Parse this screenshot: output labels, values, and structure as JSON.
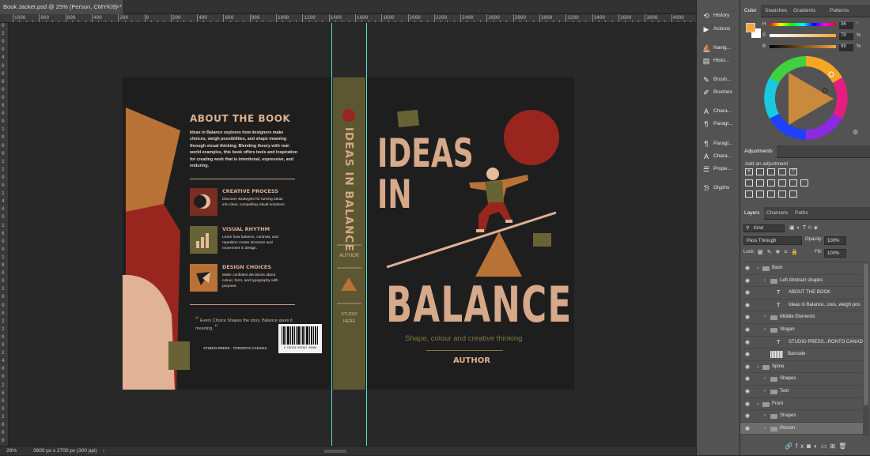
{
  "document": {
    "tab_title": "Book Jacket.psd @ 25% (Person, CMYK/8) *",
    "close": "×"
  },
  "rulers": {
    "h": [
      "1000",
      "800",
      "600",
      "400",
      "200",
      "0",
      "200",
      "400",
      "600",
      "800",
      "1000",
      "1200",
      "1400",
      "1600",
      "1800",
      "2000",
      "2200",
      "2400",
      "2600",
      "2800",
      "3000",
      "3200",
      "3400",
      "3600",
      "3800",
      "4000",
      "4200"
    ],
    "v": [
      "0",
      "2",
      "0",
      "0",
      "4",
      "0",
      "0",
      "6",
      "0",
      "0",
      "8",
      "0",
      "0",
      "1",
      "0",
      "0",
      "0",
      "1",
      "2",
      "0",
      "0",
      "1",
      "4",
      "0",
      "0",
      "1",
      "6",
      "0",
      "0",
      "1",
      "8",
      "0",
      "0",
      "2",
      "0",
      "0",
      "0",
      "2",
      "2",
      "0",
      "0",
      "2",
      "4",
      "0",
      "0",
      "2",
      "6",
      "0",
      "0",
      "2",
      "8",
      "0",
      "0"
    ]
  },
  "status": {
    "zoom": "29%",
    "doc_size": "3900 px x 2700 px (300 ppi)",
    "arrow": "›"
  },
  "back_cover": {
    "heading": "ABOUT THE BOOK",
    "body": "Ideas in Balance explores how designers make choices, weigh possibilities, and shape meaning through visual thinking. Blending theory with real-world examples, this book offers tools and inspiration for creating work that is intentional, expressive, and enduring.",
    "features": [
      {
        "title": "CREATIVE PROCESS",
        "text": "Discover strategies for turning ideas into clear, compelling visual solutions."
      },
      {
        "title": "VISUAL RHYTHM",
        "text": "Learn how balance, contrast, and repetition create structure and movement in design."
      },
      {
        "title": "DESIGN CHOICES",
        "text": "Make confident decisions about colour, form, and typography with purpose."
      }
    ],
    "quote": "Every Choice Shapes the story. Balance gives it meaning.",
    "publisher": "STUDIO PRESS · TORONTO CANADA",
    "barcode_number": "9 781234 567897 00000"
  },
  "spine": {
    "title": "IDEAS IN BALANCE",
    "author": "AUTHOR",
    "publisher": "STUDIO HERE"
  },
  "front_cover": {
    "title_line1": "IDEAS",
    "title_line2": "IN",
    "title_line3": "BALANCE",
    "subtitle": "Shape, colour and creative thinking",
    "author": "AUTHOR"
  },
  "tool_column": [
    {
      "label": "History",
      "icon": "history-icon"
    },
    {
      "label": "Actions",
      "icon": "actions-icon"
    },
    {
      "label": "Navig...",
      "icon": "navigator-icon"
    },
    {
      "label": "Histo...",
      "icon": "histogram-icon"
    },
    {
      "label": "Brush...",
      "icon": "brush-settings-icon"
    },
    {
      "label": "Brushes",
      "icon": "brushes-icon"
    },
    {
      "label": "Chara...",
      "icon": "character-icon"
    },
    {
      "label": "Paragr...",
      "icon": "paragraph-icon"
    },
    {
      "label": "Paragr...",
      "icon": "paragraph-styles-icon"
    },
    {
      "label": "Chara...",
      "icon": "character-styles-icon"
    },
    {
      "label": "Prope...",
      "icon": "properties-icon"
    },
    {
      "label": "Glyphs",
      "icon": "glyphs-icon"
    }
  ],
  "color_panel": {
    "tabs": [
      "Color",
      "Swatches",
      "Gradients",
      "Patterns"
    ],
    "active_tab": "Color",
    "sliders": [
      {
        "label": "H",
        "value": "36",
        "unit": "°"
      },
      {
        "label": "S",
        "value": "79",
        "unit": "%"
      },
      {
        "label": "B",
        "value": "99",
        "unit": "%"
      }
    ],
    "foreground": "#f7a53a",
    "background": "#ffffff"
  },
  "adjustments_panel": {
    "tab": "Adjustments",
    "hint": "Add an adjustment"
  },
  "layers_panel": {
    "tabs": [
      "Layers",
      "Channels",
      "Paths"
    ],
    "active_tab": "Layers",
    "filter_kind": "Kind",
    "blend_mode": "Pass Through",
    "opacity_label": "Opacity:",
    "opacity": "100%",
    "lock_label": "Lock:",
    "fill_label": "Fill:",
    "fill": "100%",
    "layers": [
      {
        "name": "Back",
        "type": "group",
        "indent": 0,
        "open": true
      },
      {
        "name": "Left Abstract shapes",
        "type": "group",
        "indent": 1,
        "open": false
      },
      {
        "name": "ABOUT THE BOOK",
        "type": "text",
        "indent": 1
      },
      {
        "name": "Ideas in Balance...ices, weigh pos",
        "type": "text",
        "indent": 1
      },
      {
        "name": "Middle Elements",
        "type": "group",
        "indent": 1,
        "open": false
      },
      {
        "name": "Slogan",
        "type": "group",
        "indent": 1,
        "open": false
      },
      {
        "name": "STUDIO PRESS...RONTO CANADA",
        "type": "text",
        "indent": 1
      },
      {
        "name": "Barcode",
        "type": "image",
        "indent": 1
      },
      {
        "name": "Spine",
        "type": "group",
        "indent": 0,
        "open": true
      },
      {
        "name": "Shapes",
        "type": "group",
        "indent": 1,
        "open": false
      },
      {
        "name": "Text",
        "type": "group",
        "indent": 1,
        "open": false
      },
      {
        "name": "Front",
        "type": "group",
        "indent": 0,
        "open": true
      },
      {
        "name": "Shapes",
        "type": "group",
        "indent": 1,
        "open": false
      },
      {
        "name": "Person",
        "type": "group",
        "indent": 1,
        "open": false,
        "selected": true
      }
    ]
  }
}
